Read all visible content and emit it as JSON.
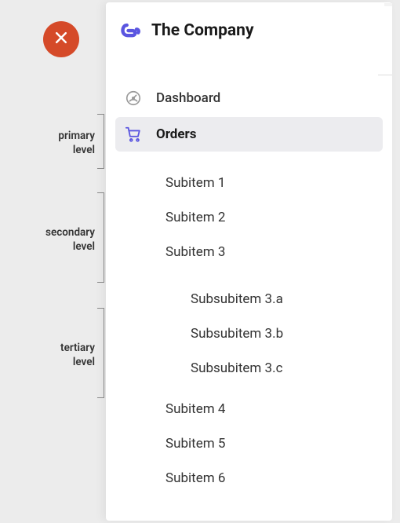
{
  "header": {
    "company_name": "The Company"
  },
  "annotations": {
    "primary": "primary\nlevel",
    "secondary": "secondary\nlevel",
    "tertiary": "tertiary\nlevel"
  },
  "menu": {
    "items": [
      {
        "label": "Dashboard",
        "icon": "gauge-icon",
        "active": false
      },
      {
        "label": "Orders",
        "icon": "cart-icon",
        "active": true
      }
    ],
    "subitems": [
      {
        "label": "Subitem 1"
      },
      {
        "label": "Subitem 2"
      },
      {
        "label": "Subitem 3"
      }
    ],
    "subsubitems": [
      {
        "label": "Subsubitem 3.a"
      },
      {
        "label": "Subsubitem 3.b"
      },
      {
        "label": "Subsubitem 3.c"
      }
    ],
    "subitems_after": [
      {
        "label": "Subitem 4"
      },
      {
        "label": "Subitem 5"
      },
      {
        "label": "Subitem 6"
      }
    ]
  },
  "colors": {
    "accent": "#5a55e0",
    "close": "#d54a29",
    "active_bg": "#ececef"
  }
}
